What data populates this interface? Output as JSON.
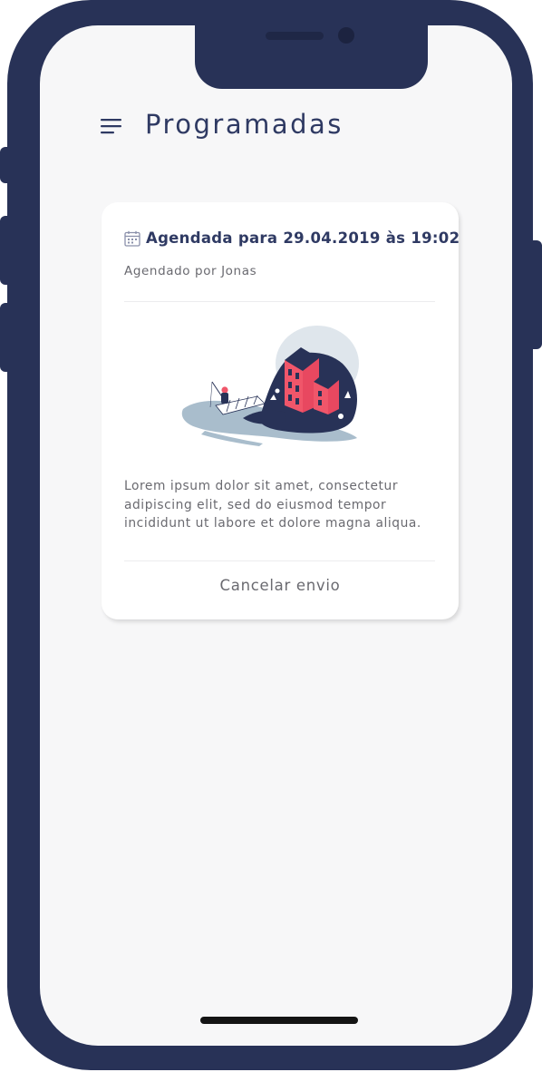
{
  "header": {
    "title": "Programadas",
    "menu_icon": "hamburger-menu-icon"
  },
  "scheduled_message": {
    "calendar_icon": "calendar-icon",
    "schedule_label": "Agendada para 29.04.2019 às 19:02",
    "scheduled_by": "Agendado por Jonas",
    "illustration": "houses-on-island-illustration",
    "description": "Lorem ipsum dolor sit amet, consectetur adipiscing elit, sed do eiusmod tempor incididunt ut labore et dolore magna aliqua.",
    "cancel_label": "Cancelar envio"
  },
  "colors": {
    "device_frame": "#283257",
    "title_text": "#2f3a63",
    "body_text": "#6a6a70",
    "screen_background": "#f7f7f8",
    "illustration_accent": "#f0566a"
  }
}
